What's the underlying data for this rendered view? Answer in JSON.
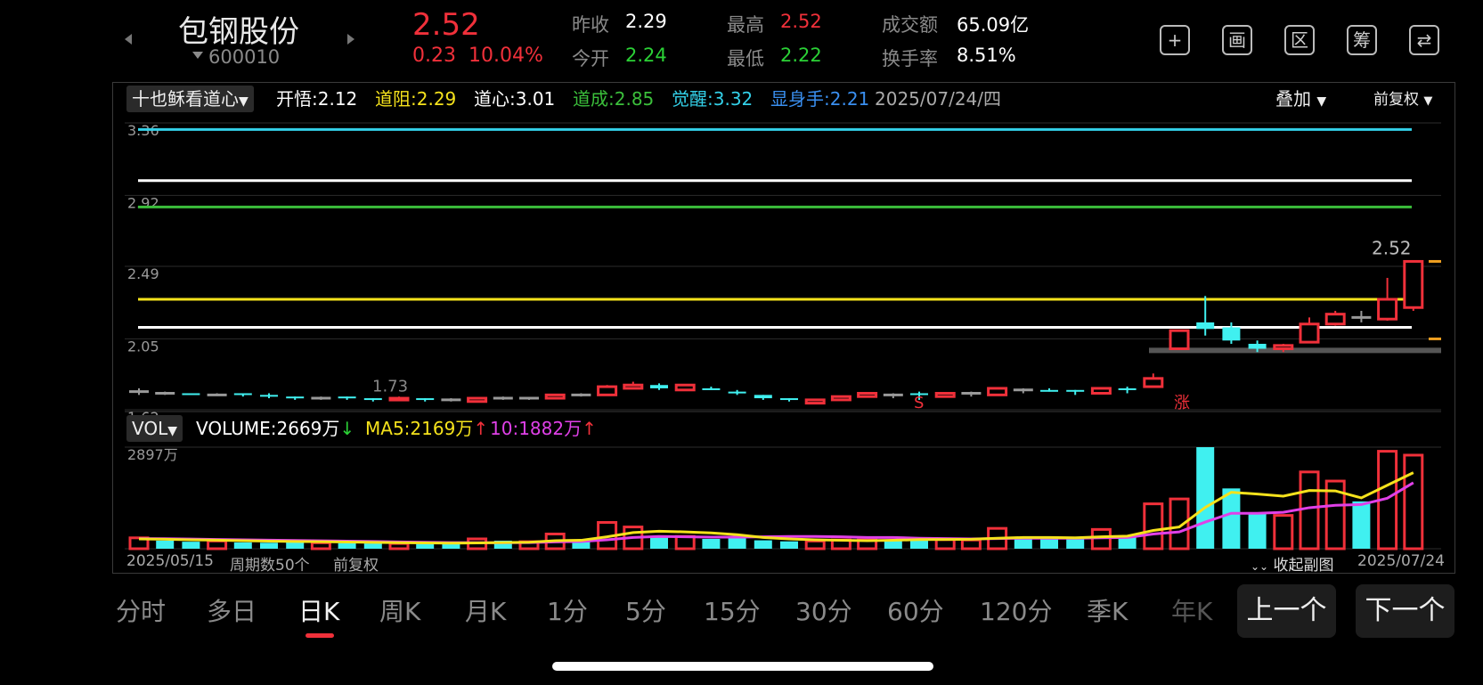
{
  "header": {
    "stock_name": "包钢股份",
    "stock_code": "600010",
    "price": "2.52",
    "change_abs": "0.23",
    "change_pct": "10.04%",
    "stats": [
      {
        "label": "昨收",
        "value": "2.29",
        "color": "#ffffff"
      },
      {
        "label": "今开",
        "value": "2.24",
        "color": "#2bd136"
      },
      {
        "label": "最高",
        "value": "2.52",
        "color": "#f0303a"
      },
      {
        "label": "最低",
        "value": "2.22",
        "color": "#2bd136"
      },
      {
        "label": "成交额",
        "value": "65.09亿",
        "color": "#ffffff"
      },
      {
        "label": "换手率",
        "value": "8.51%",
        "color": "#ffffff"
      }
    ],
    "icons": [
      {
        "name": "add-icon",
        "glyph": "+"
      },
      {
        "name": "chart-icon",
        "glyph": "画"
      },
      {
        "name": "range-icon",
        "glyph": "区"
      },
      {
        "name": "chip-icon",
        "glyph": "筹"
      },
      {
        "name": "switch-screen-icon",
        "glyph": "⇄"
      }
    ]
  },
  "indicator": {
    "name": "十也稣看道心",
    "items": [
      {
        "label": "开悟:2.12",
        "color": "#ffffff"
      },
      {
        "label": "道阻:2.29",
        "color": "#f5e21c"
      },
      {
        "label": "道心:3.01",
        "color": "#ffffff"
      },
      {
        "label": "道成:2.85",
        "color": "#3bbf3b"
      },
      {
        "label": "觉醒:3.32",
        "color": "#33d0e8"
      },
      {
        "label": "显身手:2.21",
        "color": "#3a8ff0"
      }
    ],
    "date": "2025/07/24/四",
    "overlay": "叠加",
    "adjust": "前复权"
  },
  "volume_bar": {
    "name": "VOL",
    "volume": "VOLUME:2669万",
    "volume_arrow": "↓",
    "ma5": "MA5:2169万",
    "ma5_arrow": "↑",
    "ma10": "10:1882万",
    "ma10_arrow": "↑"
  },
  "footer_labels": {
    "start_date": "2025/05/15",
    "period_count": "周期数50个",
    "adjust": "前复权",
    "collapse": "收起副图",
    "end_date": "2025/07/24"
  },
  "tabs": [
    "分时",
    "多日",
    "日K",
    "周K",
    "月K",
    "1分",
    "5分",
    "15分",
    "30分",
    "60分",
    "120分",
    "季K",
    "年K"
  ],
  "active_tab": "日K",
  "buttons": {
    "prev": "上一个",
    "next": "下一个"
  },
  "chart_data": {
    "type": "candlestick",
    "price_axis": {
      "ticks": [
        "3.36",
        "2.92",
        "2.49",
        "2.05",
        "1.62"
      ],
      "ylim": [
        1.62,
        3.36
      ]
    },
    "volume_axis": {
      "top_label": "2897万",
      "ylim": [
        0,
        2897
      ]
    },
    "price_annotations": [
      "1.73",
      "2.52"
    ],
    "markers": [
      {
        "text": "S",
        "color": "#f0303a",
        "x_index": 30
      },
      {
        "text": "涨",
        "color": "#f0303a",
        "x_index": 40
      }
    ],
    "horizontal_lines": [
      {
        "value": 3.32,
        "color": "#33d0e8"
      },
      {
        "value": 3.01,
        "color": "#ffffff"
      },
      {
        "value": 2.85,
        "color": "#3bbf3b"
      },
      {
        "value": 2.29,
        "color": "#f5e21c"
      },
      {
        "value": 2.12,
        "color": "#ffffff"
      }
    ],
    "candles": [
      {
        "o": 1.73,
        "c": 1.73,
        "h": 1.75,
        "l": 1.71
      },
      {
        "o": 1.72,
        "c": 1.72,
        "h": 1.73,
        "l": 1.71
      },
      {
        "o": 1.72,
        "c": 1.71,
        "h": 1.72,
        "l": 1.71
      },
      {
        "o": 1.71,
        "c": 1.71,
        "h": 1.72,
        "l": 1.71
      },
      {
        "o": 1.72,
        "c": 1.71,
        "h": 1.72,
        "l": 1.7
      },
      {
        "o": 1.71,
        "c": 1.7,
        "h": 1.72,
        "l": 1.69
      },
      {
        "o": 1.7,
        "c": 1.69,
        "h": 1.7,
        "l": 1.68
      },
      {
        "o": 1.69,
        "c": 1.69,
        "h": 1.7,
        "l": 1.68
      },
      {
        "o": 1.7,
        "c": 1.69,
        "h": 1.7,
        "l": 1.68
      },
      {
        "o": 1.69,
        "c": 1.68,
        "h": 1.69,
        "l": 1.67
      },
      {
        "o": 1.68,
        "c": 1.69,
        "h": 1.7,
        "l": 1.68
      },
      {
        "o": 1.69,
        "c": 1.68,
        "h": 1.69,
        "l": 1.67
      },
      {
        "o": 1.68,
        "c": 1.68,
        "h": 1.69,
        "l": 1.67
      },
      {
        "o": 1.67,
        "c": 1.69,
        "h": 1.69,
        "l": 1.67
      },
      {
        "o": 1.69,
        "c": 1.69,
        "h": 1.7,
        "l": 1.68
      },
      {
        "o": 1.69,
        "c": 1.69,
        "h": 1.69,
        "l": 1.68
      },
      {
        "o": 1.69,
        "c": 1.71,
        "h": 1.71,
        "l": 1.69
      },
      {
        "o": 1.71,
        "c": 1.71,
        "h": 1.72,
        "l": 1.7
      },
      {
        "o": 1.71,
        "c": 1.76,
        "h": 1.77,
        "l": 1.71
      },
      {
        "o": 1.75,
        "c": 1.77,
        "h": 1.79,
        "l": 1.75
      },
      {
        "o": 1.77,
        "c": 1.75,
        "h": 1.78,
        "l": 1.74
      },
      {
        "o": 1.74,
        "c": 1.77,
        "h": 1.77,
        "l": 1.74
      },
      {
        "o": 1.75,
        "c": 1.74,
        "h": 1.76,
        "l": 1.74
      },
      {
        "o": 1.73,
        "c": 1.72,
        "h": 1.74,
        "l": 1.71
      },
      {
        "o": 1.71,
        "c": 1.69,
        "h": 1.71,
        "l": 1.68
      },
      {
        "o": 1.69,
        "c": 1.68,
        "h": 1.69,
        "l": 1.67
      },
      {
        "o": 1.66,
        "c": 1.68,
        "h": 1.68,
        "l": 1.66
      },
      {
        "o": 1.68,
        "c": 1.7,
        "h": 1.7,
        "l": 1.68
      },
      {
        "o": 1.7,
        "c": 1.72,
        "h": 1.72,
        "l": 1.7
      },
      {
        "o": 1.71,
        "c": 1.71,
        "h": 1.72,
        "l": 1.69
      },
      {
        "o": 1.72,
        "c": 1.71,
        "h": 1.73,
        "l": 1.68
      },
      {
        "o": 1.7,
        "c": 1.72,
        "h": 1.72,
        "l": 1.7
      },
      {
        "o": 1.72,
        "c": 1.72,
        "h": 1.73,
        "l": 1.7
      },
      {
        "o": 1.71,
        "c": 1.75,
        "h": 1.75,
        "l": 1.71
      },
      {
        "o": 1.74,
        "c": 1.74,
        "h": 1.75,
        "l": 1.72
      },
      {
        "o": 1.74,
        "c": 1.73,
        "h": 1.75,
        "l": 1.73
      },
      {
        "o": 1.74,
        "c": 1.73,
        "h": 1.74,
        "l": 1.71
      },
      {
        "o": 1.72,
        "c": 1.75,
        "h": 1.75,
        "l": 1.72
      },
      {
        "o": 1.75,
        "c": 1.74,
        "h": 1.76,
        "l": 1.72
      },
      {
        "o": 1.76,
        "c": 1.81,
        "h": 1.84,
        "l": 1.76
      },
      {
        "o": 1.99,
        "c": 2.1,
        "h": 2.1,
        "l": 1.99
      },
      {
        "o": 2.15,
        "c": 2.11,
        "h": 2.31,
        "l": 2.07
      },
      {
        "o": 2.12,
        "c": 2.04,
        "h": 2.15,
        "l": 2.02
      },
      {
        "o": 2.02,
        "c": 1.99,
        "h": 2.04,
        "l": 1.97
      },
      {
        "o": 1.99,
        "c": 2.01,
        "h": 2.02,
        "l": 1.97
      },
      {
        "o": 2.03,
        "c": 2.14,
        "h": 2.18,
        "l": 2.03
      },
      {
        "o": 2.14,
        "c": 2.2,
        "h": 2.22,
        "l": 2.13
      },
      {
        "o": 2.18,
        "c": 2.18,
        "h": 2.22,
        "l": 2.15
      },
      {
        "o": 2.17,
        "c": 2.29,
        "h": 2.42,
        "l": 2.16
      },
      {
        "o": 2.24,
        "c": 2.52,
        "h": 2.52,
        "l": 2.22
      }
    ],
    "volumes": [
      {
        "v": 310,
        "up": true
      },
      {
        "v": 230,
        "up": false
      },
      {
        "v": 200,
        "up": false
      },
      {
        "v": 220,
        "up": true
      },
      {
        "v": 180,
        "up": false
      },
      {
        "v": 170,
        "up": false
      },
      {
        "v": 190,
        "up": false
      },
      {
        "v": 170,
        "up": true
      },
      {
        "v": 160,
        "up": false
      },
      {
        "v": 150,
        "up": false
      },
      {
        "v": 150,
        "up": true
      },
      {
        "v": 140,
        "up": false
      },
      {
        "v": 140,
        "up": false
      },
      {
        "v": 280,
        "up": true
      },
      {
        "v": 230,
        "up": false
      },
      {
        "v": 200,
        "up": true
      },
      {
        "v": 420,
        "up": true
      },
      {
        "v": 250,
        "up": false
      },
      {
        "v": 750,
        "up": true
      },
      {
        "v": 620,
        "up": true
      },
      {
        "v": 360,
        "up": false
      },
      {
        "v": 350,
        "up": true
      },
      {
        "v": 280,
        "up": false
      },
      {
        "v": 300,
        "up": false
      },
      {
        "v": 240,
        "up": false
      },
      {
        "v": 210,
        "up": false
      },
      {
        "v": 220,
        "up": true
      },
      {
        "v": 250,
        "up": true
      },
      {
        "v": 250,
        "up": true
      },
      {
        "v": 260,
        "up": false
      },
      {
        "v": 330,
        "up": false
      },
      {
        "v": 260,
        "up": true
      },
      {
        "v": 250,
        "up": true
      },
      {
        "v": 580,
        "up": true
      },
      {
        "v": 290,
        "up": false
      },
      {
        "v": 280,
        "up": false
      },
      {
        "v": 270,
        "up": false
      },
      {
        "v": 550,
        "up": true
      },
      {
        "v": 350,
        "up": false
      },
      {
        "v": 1280,
        "up": true
      },
      {
        "v": 1420,
        "up": true
      },
      {
        "v": 2897,
        "up": false
      },
      {
        "v": 1720,
        "up": false
      },
      {
        "v": 1020,
        "up": false
      },
      {
        "v": 950,
        "up": true
      },
      {
        "v": 2190,
        "up": true
      },
      {
        "v": 1930,
        "up": true
      },
      {
        "v": 1350,
        "up": false
      },
      {
        "v": 2780,
        "up": true
      },
      {
        "v": 2669,
        "up": true
      }
    ],
    "ma5": [
      280,
      270,
      255,
      245,
      230,
      215,
      205,
      200,
      190,
      180,
      170,
      165,
      160,
      165,
      175,
      185,
      230,
      240,
      340,
      460,
      500,
      480,
      450,
      400,
      320,
      280,
      255,
      240,
      230,
      240,
      260,
      265,
      270,
      300,
      320,
      320,
      310,
      340,
      360,
      520,
      620,
      1180,
      1610,
      1560,
      1500,
      1660,
      1650,
      1450,
      1810,
      2169
    ],
    "ma10": [
      290,
      285,
      275,
      265,
      255,
      245,
      235,
      225,
      215,
      205,
      195,
      185,
      175,
      170,
      170,
      175,
      195,
      205,
      255,
      320,
      350,
      340,
      330,
      330,
      340,
      350,
      350,
      340,
      320,
      320,
      300,
      290,
      280,
      290,
      300,
      300,
      300,
      310,
      320,
      420,
      480,
      760,
      1010,
      1010,
      1040,
      1170,
      1240,
      1260,
      1440,
      1882
    ]
  }
}
